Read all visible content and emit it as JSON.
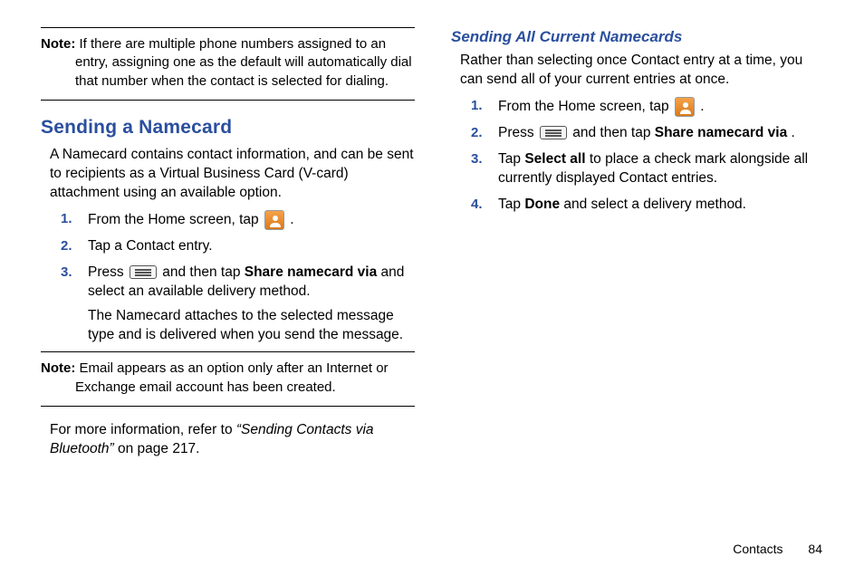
{
  "left": {
    "note1": {
      "label": "Note:",
      "text": "If there are multiple phone numbers assigned to an entry, assigning one as the default will automatically dial that number when the contact is selected for dialing."
    },
    "heading": "Sending a Namecard",
    "intro": "A Namecard contains contact information, and can be sent to recipients as a Virtual Business Card (V-card) attachment using an available option.",
    "steps": [
      {
        "n": "1.",
        "pre": "From the Home screen, tap ",
        "post": "."
      },
      {
        "n": "2.",
        "text": "Tap a Contact entry."
      },
      {
        "n": "3.",
        "pre": "Press ",
        "mid": " and then tap ",
        "bold": "Share namecard via",
        "post": " and select an available delivery method.",
        "extra": "The Namecard attaches to the selected message type and is delivered when you send the message."
      }
    ],
    "note2": {
      "label": "Note:",
      "text": "Email appears as an option only after an Internet or Exchange email account has been created."
    },
    "refer_pre": "For more information, refer to ",
    "refer_link": "“Sending Contacts via Bluetooth”",
    "refer_post": "  on page 217."
  },
  "right": {
    "heading": "Sending All Current Namecards",
    "intro": "Rather than selecting once Contact entry at a time, you can send all of your current entries at once.",
    "steps": [
      {
        "n": "1.",
        "pre": "From the Home screen, tap ",
        "post": "."
      },
      {
        "n": "2.",
        "pre": "Press ",
        "mid": " and then tap ",
        "bold": "Share namecard via",
        "post": "."
      },
      {
        "n": "3.",
        "pre": "Tap ",
        "bold": "Select all",
        "post": " to place a check mark alongside all currently displayed Contact entries."
      },
      {
        "n": "4.",
        "pre": "Tap ",
        "bold": "Done",
        "post": " and select a delivery method."
      }
    ]
  },
  "footer": {
    "section": "Contacts",
    "page": "84"
  }
}
